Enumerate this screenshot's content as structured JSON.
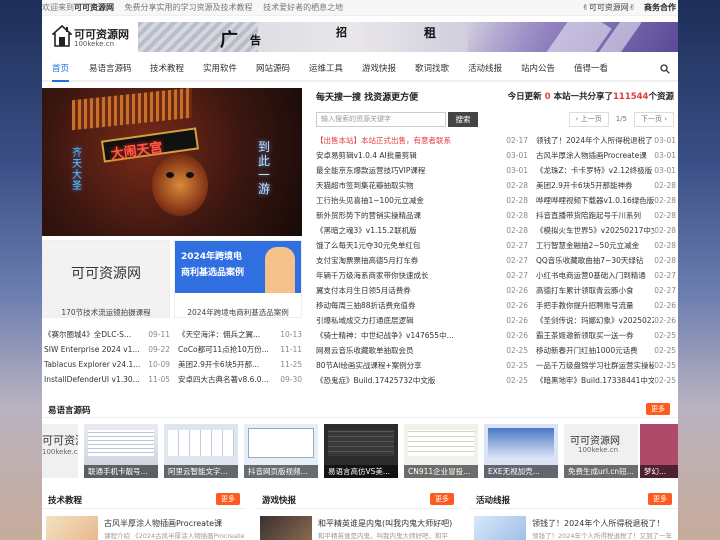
{
  "topbar": {
    "welcome_prefix": "欢迎来到",
    "site_name": "可可资源网",
    "slogan1": "免费分享实用的学习资源及技术教程",
    "slogan2": "技术爱好者的栖息之地",
    "right_link": "✌可可资源网✌",
    "biz": "商务合作"
  },
  "logo": {
    "name": "可可资源网",
    "domain": "100keke.cn"
  },
  "banner": {
    "w1": "广",
    "w2": "告",
    "w3": "招",
    "w4": "租"
  },
  "nav": [
    "首页",
    "易语言源码",
    "技术教程",
    "实用软件",
    "网站源码",
    "运维工具",
    "游戏快报",
    "歌词找歌",
    "活动线报",
    "站内公告",
    "值得一看"
  ],
  "hero": {
    "sign": "大闹天宫",
    "neon1": "到此一游",
    "neon2": "齐天大圣"
  },
  "card_left": {
    "big": "可可资源网",
    "caption": "170节技术流运镜拍摄课程"
  },
  "card_right": {
    "line1": "2024年跨境电",
    "line2": "商利基选品案例",
    "caption": "2024年跨境电商利基选品案例"
  },
  "left_list": [
    {
      "title": "《赛尔圈城4》全DLC-S...",
      "date": "09-11"
    },
    {
      "title": "《天空海洋：佣兵之翼...",
      "date": "10-13"
    },
    {
      "title": "SIW Enterprise 2024 v1...",
      "date": "09-22"
    },
    {
      "title": "CoCo都可11点抢10万份...",
      "date": "11-11"
    },
    {
      "title": "Tablacus Explorer v24.1...",
      "date": "10-09"
    },
    {
      "title": "美团2.9开卡6块5开那...",
      "date": "11-25"
    },
    {
      "title": "InstallDefenderUI v1.30...",
      "date": "11-05"
    },
    {
      "title": "安卓四大古典名著v8.6.0...",
      "date": "09-30"
    }
  ],
  "right_panel": {
    "heading": "每天搜一搜 找资源更方便",
    "today_label": "今日更新",
    "today_count": "0",
    "total_label": "本站一共分享了",
    "total_count": "111544",
    "total_unit": "个资源",
    "search_placeholder": "输入搜索的资源关键字",
    "search_button": "搜索",
    "prev": "‹ 上一页",
    "page": "1/5",
    "next": "下一页 ›"
  },
  "mid_list": [
    {
      "title": "【出售本站】本站正式出售，有意者联系",
      "date": "02-17",
      "hot": true
    },
    {
      "title": "安卓易剪辑v1.0.4 AI批量剪辑",
      "date": "03-01"
    },
    {
      "title": "最全能京东爆款运营技巧VIP课程",
      "date": "03-01"
    },
    {
      "title": "天猫超市签到集花瓣抽取实物",
      "date": "02-28"
    },
    {
      "title": "工行抬头见喜抽1~100元立减金",
      "date": "02-28"
    },
    {
      "title": "新外贸形势下的营销实操精品课",
      "date": "02-28"
    },
    {
      "title": "《黑暗之魂3》v1.15.2联机版",
      "date": "02-28"
    },
    {
      "title": "饿了么每天1元夺30元免单红包",
      "date": "02-27"
    },
    {
      "title": "支付宝淘票票抽高德5月打车券",
      "date": "02-27"
    },
    {
      "title": "年辆千万级海系商家带你快速成长",
      "date": "02-27"
    },
    {
      "title": "翼支付本月生日领5月话费券",
      "date": "02-26"
    },
    {
      "title": "移动每周三抽88折话费充值券",
      "date": "02-26"
    },
    {
      "title": "引爆私域成交力打通底层逻辑",
      "date": "02-26"
    },
    {
      "title": "《骑士精神：中世纪战争》v147655中...",
      "date": "02-26"
    },
    {
      "title": "网易云音乐收藏歌单抽取会员",
      "date": "02-25"
    },
    {
      "title": "80节AI绘画实战课程+案例分享",
      "date": "02-25"
    },
    {
      "title": "《恐鬼症》Build.17425732中文版",
      "date": "02-25"
    }
  ],
  "far_list": [
    {
      "title": "领钱了！2024年个人所得税退税了！",
      "date": "03-01"
    },
    {
      "title": "古风半厚涂人物插画Procreate课",
      "date": "03-01"
    },
    {
      "title": "《龙珠Z：卡卡罗特》v2.12终极版",
      "date": "03-01"
    },
    {
      "title": "美团2.9开卡6块5开那能神券",
      "date": "02-28"
    },
    {
      "title": "哗哩哗哩视频下载器v1.0.16绿色版",
      "date": "02-28"
    },
    {
      "title": "抖音直播带货陪跑起号千川系列",
      "date": "02-28"
    },
    {
      "title": "《模拟火车世界5》v20250217中文版",
      "date": "02-28"
    },
    {
      "title": "工行智慧金融抽2~50元立减金",
      "date": "02-28"
    },
    {
      "title": "QQ音乐收藏歌曲抽7~30天绿钻",
      "date": "02-28"
    },
    {
      "title": "小红书电商运营0基础入门到精通",
      "date": "02-27"
    },
    {
      "title": "高德打车累计领取青云豚小食",
      "date": "02-27"
    },
    {
      "title": "手把手教你提升招聘账号流量",
      "date": "02-26"
    },
    {
      "title": "《圣剑传说：玛娜幻象》v20250225中...",
      "date": "02-26"
    },
    {
      "title": "霸王茶姬邀新领取买一送一券",
      "date": "02-25"
    },
    {
      "title": "移动新春开门红抽1000元话费",
      "date": "02-25"
    },
    {
      "title": "一品千万级盘锦学习社群运营实操秘要",
      "date": "02-25"
    },
    {
      "title": "《暗黑地牢》Build.17338441中文版",
      "date": "02-25"
    }
  ],
  "section_easy": {
    "title": "易语言源码",
    "more": "更多"
  },
  "strip": [
    {
      "label": "联通手机卡靓号..."
    },
    {
      "label": "阿里云智能文字..."
    },
    {
      "label": "抖音网页版视频..."
    },
    {
      "label": "易语言高仿VS美..."
    },
    {
      "label": "CN911企业冒投..."
    },
    {
      "label": "EXE无视加壳..."
    },
    {
      "label": "免费生成url.cn短..."
    },
    {
      "label": "梦幻..."
    }
  ],
  "strip_logo": {
    "big": "可可资源网",
    "domain": "100keke.cn"
  },
  "bottom": [
    {
      "title": "技术教程",
      "more": "更多",
      "item": "古风半厚涂人物插画Procreate课",
      "sub": "课程介绍 《2024古风半厚涂人物插画Procreate"
    },
    {
      "title": "游戏快报",
      "more": "更多",
      "item": "和平精英谁是内鬼(叫我内鬼大师好吧)",
      "sub": "和平精英谁是内鬼，叫我内鬼大师好吧，和平"
    },
    {
      "title": "活动线报",
      "more": "更多",
      "item": "领钱了！2024年个人所得税退税了！",
      "sub": "领钱了！2024年个人所得税退税了！又到了一年"
    }
  ]
}
